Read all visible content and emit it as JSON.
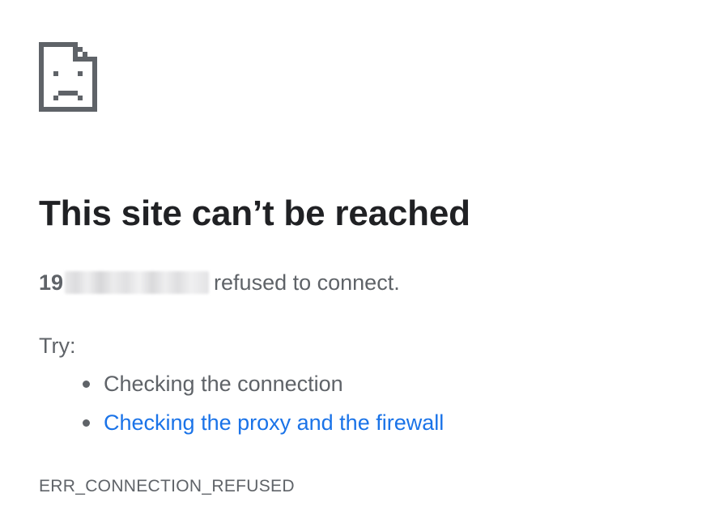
{
  "icon": "sad-page-icon",
  "title": "This site can’t be reached",
  "message": {
    "host_visible": "19",
    "host_redacted": true,
    "text": "refused to connect."
  },
  "try_label": "Try:",
  "suggestions": [
    {
      "label": "Checking the connection",
      "is_link": false
    },
    {
      "label": "Checking the proxy and the firewall",
      "is_link": true
    }
  ],
  "error_code": "ERR_CONNECTION_REFUSED",
  "colors": {
    "title": "#202124",
    "body": "#5f6368",
    "link": "#1a73e8",
    "icon": "#5f6368"
  }
}
